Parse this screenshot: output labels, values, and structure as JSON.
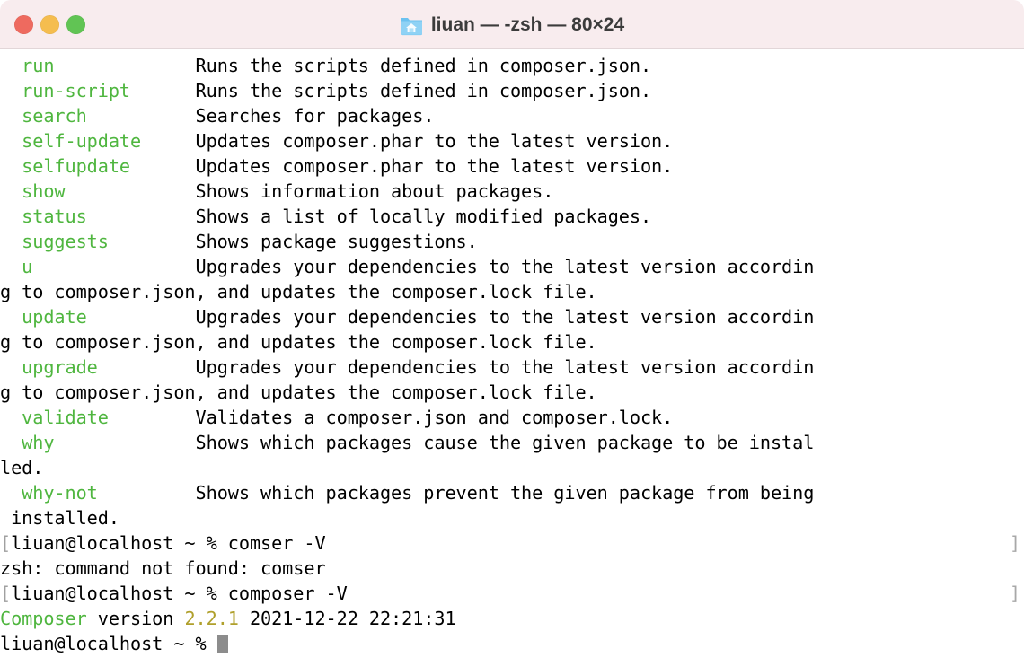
{
  "window": {
    "title": "liuan — -zsh — 80×24",
    "icon": "home-folder-icon",
    "traffic_lights": {
      "close_color": "#ee6a5f",
      "minimize_color": "#f5bd4f",
      "zoom_color": "#61c454"
    },
    "titlebar_color": "#f8ecee",
    "background_color": "#ffffff"
  },
  "colors": {
    "command_green": "#4fb63f",
    "version_yellow": "#b0a02c",
    "text_black": "#000000",
    "prompt_mark_gray": "#a8a8a8",
    "cursor_gray": "#8c8c8c"
  },
  "terminal": {
    "size": "80×24",
    "shell": "-zsh",
    "lines": [
      {
        "id": "line-run",
        "indent": "  ",
        "command": "run",
        "pad": "             ",
        "text": "Runs the scripts defined in composer.json."
      },
      {
        "id": "line-run-script",
        "indent": "  ",
        "command": "run-script",
        "pad": "      ",
        "text": "Runs the scripts defined in composer.json."
      },
      {
        "id": "line-search",
        "indent": "  ",
        "command": "search",
        "pad": "          ",
        "text": "Searches for packages."
      },
      {
        "id": "line-self-update",
        "indent": "  ",
        "command": "self-update",
        "pad": "     ",
        "text": "Updates composer.phar to the latest version."
      },
      {
        "id": "line-selfupdate",
        "indent": "  ",
        "command": "selfupdate",
        "pad": "      ",
        "text": "Updates composer.phar to the latest version."
      },
      {
        "id": "line-show",
        "indent": "  ",
        "command": "show",
        "pad": "            ",
        "text": "Shows information about packages."
      },
      {
        "id": "line-status",
        "indent": "  ",
        "command": "status",
        "pad": "          ",
        "text": "Shows a list of locally modified packages."
      },
      {
        "id": "line-suggests",
        "indent": "  ",
        "command": "suggests",
        "pad": "        ",
        "text": "Shows package suggestions."
      },
      {
        "id": "line-u",
        "indent": "  ",
        "command": "u",
        "pad": "               ",
        "text": "Upgrades your dependencies to the latest version accordin"
      },
      {
        "id": "line-u-wrap",
        "indent": "",
        "command": "",
        "pad": "",
        "text": "g to composer.json, and updates the composer.lock file."
      },
      {
        "id": "line-update",
        "indent": "  ",
        "command": "update",
        "pad": "          ",
        "text": "Upgrades your dependencies to the latest version accordin"
      },
      {
        "id": "line-update-wrap",
        "indent": "",
        "command": "",
        "pad": "",
        "text": "g to composer.json, and updates the composer.lock file."
      },
      {
        "id": "line-upgrade",
        "indent": "  ",
        "command": "upgrade",
        "pad": "         ",
        "text": "Upgrades your dependencies to the latest version accordin"
      },
      {
        "id": "line-upgrade-wrap",
        "indent": "",
        "command": "",
        "pad": "",
        "text": "g to composer.json, and updates the composer.lock file."
      },
      {
        "id": "line-validate",
        "indent": "  ",
        "command": "validate",
        "pad": "        ",
        "text": "Validates a composer.json and composer.lock."
      },
      {
        "id": "line-why",
        "indent": "  ",
        "command": "why",
        "pad": "             ",
        "text": "Shows which packages cause the given package to be instal"
      },
      {
        "id": "line-why-wrap",
        "indent": "",
        "command": "",
        "pad": "",
        "text": "led."
      },
      {
        "id": "line-why-not",
        "indent": "  ",
        "command": "why-not",
        "pad": "         ",
        "text": "Shows which packages prevent the given package from being"
      },
      {
        "id": "line-why-not-wrap",
        "indent": "",
        "command": "",
        "pad": "",
        "text": " installed."
      }
    ],
    "prompt_lines": [
      {
        "id": "prompt-1",
        "left_mark": "[",
        "right_mark": "]",
        "prompt": "liuan@localhost ~ % ",
        "command": "comser -V"
      },
      {
        "id": "output-1",
        "left_mark": "",
        "right_mark": "",
        "prompt": "",
        "command": "zsh: command not found: comser"
      },
      {
        "id": "prompt-2",
        "left_mark": "[",
        "right_mark": "]",
        "prompt": "liuan@localhost ~ % ",
        "command": "composer -V"
      }
    ],
    "version_line": {
      "app": "Composer",
      "label": " version ",
      "version": "2.2.1",
      "date": " 2021-12-22 22:21:31"
    },
    "final_prompt": {
      "prompt": "liuan@localhost ~ % ",
      "cursor": "block-cursor"
    }
  }
}
